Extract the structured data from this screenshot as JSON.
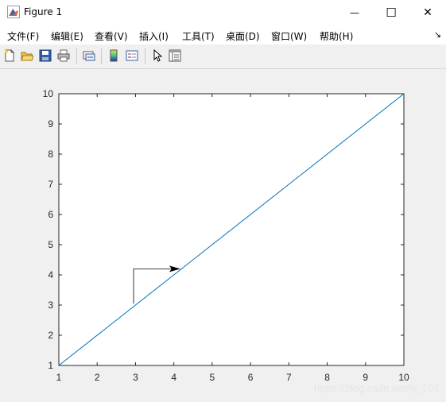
{
  "window": {
    "title": "Figure 1",
    "minimize_glyph": "—",
    "maximize_glyph": "☐",
    "close_glyph": "✕"
  },
  "menu": {
    "items": [
      {
        "label": "文件(F)"
      },
      {
        "label": "编辑(E)"
      },
      {
        "label": "查看(V)"
      },
      {
        "label": "插入(I)"
      },
      {
        "label": "工具(T)"
      },
      {
        "label": "桌面(D)"
      },
      {
        "label": "窗口(W)"
      },
      {
        "label": "帮助(H)"
      }
    ],
    "overflow_glyph": "↘"
  },
  "toolbar": {
    "buttons": [
      {
        "icon": "new-figure-icon"
      },
      {
        "icon": "open-file-icon"
      },
      {
        "icon": "save-icon"
      },
      {
        "icon": "print-icon"
      },
      {
        "icon": "link-plot-icon"
      },
      {
        "icon": "insert-colorbar-icon"
      },
      {
        "icon": "insert-legend-icon"
      },
      {
        "icon": "edit-plot-pointer-icon"
      },
      {
        "icon": "property-inspector-icon"
      }
    ]
  },
  "chart_data": {
    "type": "line",
    "x": [
      1,
      10
    ],
    "series": [
      {
        "values": [
          1,
          10
        ],
        "color": "#0072bd"
      }
    ],
    "xlim": [
      1,
      10
    ],
    "ylim": [
      1,
      10
    ],
    "xticks": [
      "1",
      "2",
      "3",
      "4",
      "5",
      "6",
      "7",
      "8",
      "9",
      "10"
    ],
    "yticks": [
      "1",
      "2",
      "3",
      "4",
      "5",
      "6",
      "7",
      "8",
      "9",
      "10"
    ],
    "grid": false,
    "annotation": {
      "type": "arrow",
      "path": [
        [
          2.95,
          3.05
        ],
        [
          2.95,
          4.2
        ],
        [
          4.15,
          4.2
        ]
      ],
      "color": "#000000"
    }
  },
  "watermark": "https://blog.csdn.net/jk_101"
}
